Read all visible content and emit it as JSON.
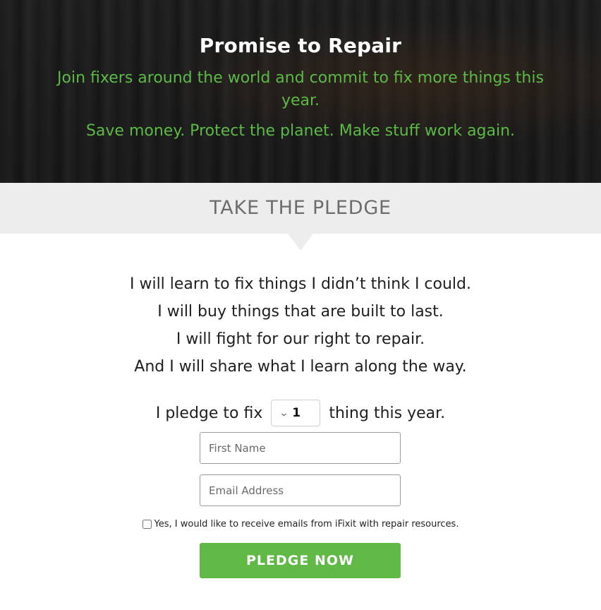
{
  "hero": {
    "title": "Promise to Repair",
    "subtitle": "Join fixers around the world and commit to fix more things this year.",
    "tagline": "Save money. Protect the planet. Make stuff work again."
  },
  "pledge_band": {
    "title": "TAKE THE PLEDGE"
  },
  "promises": [
    "I will learn to fix things I didn’t think I could.",
    "I will buy things that are built to last.",
    "I will fight for our right to repair.",
    "And I will share what I learn along the way."
  ],
  "pledge_row": {
    "prefix": "I pledge to fix",
    "selected_quantity": "1",
    "suffix": "thing this year."
  },
  "form": {
    "first_name_placeholder": "First Name",
    "email_placeholder": "Email Address",
    "optin_label": "Yes, I would like to receive emails from iFixit with repair resources.",
    "optin_checked": false,
    "submit_label": "PLEDGE NOW"
  },
  "colors": {
    "accent_green": "#5fb944",
    "hero_text_green": "#5cb946",
    "band_gray": "#ededed"
  }
}
